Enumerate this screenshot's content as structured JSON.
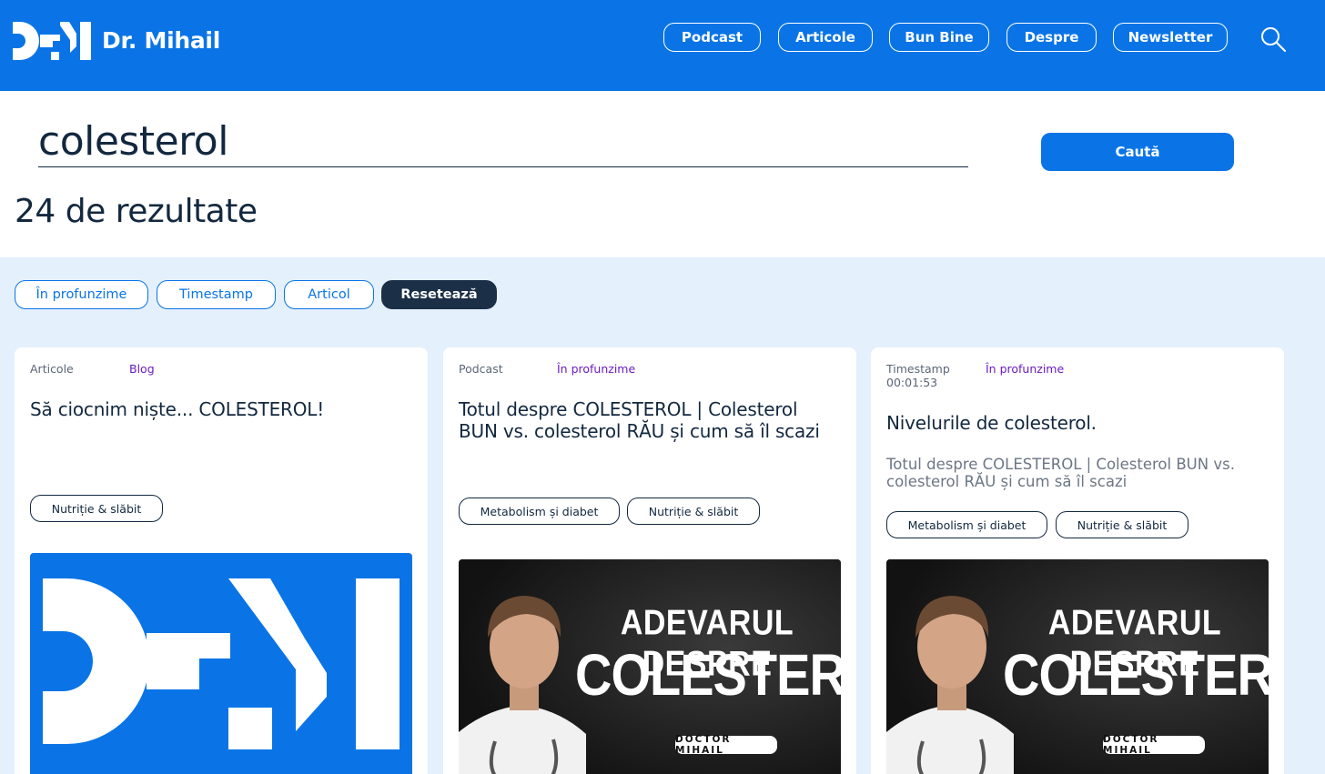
{
  "header": {
    "brand": "Dr. Mihail",
    "nav": [
      "Podcast",
      "Articole",
      "Bun Bine",
      "Despre",
      "Newsletter"
    ]
  },
  "search": {
    "query": "colesterol",
    "button_label": "Caută",
    "results_count": "24 de rezultate"
  },
  "filters": [
    "În profunzime",
    "Timestamp",
    "Articol",
    "Resetează"
  ],
  "cards": [
    {
      "type": "Articole",
      "tag": "Blog",
      "title": "Să ciocnim niște... COLESTEROL!",
      "chips": [
        "Nutriție & slăbit"
      ],
      "image": "logo-thumbnail"
    },
    {
      "type": "Podcast",
      "tag": "În profunzime",
      "title": "Totul despre COLESTEROL | Colesterol BUN vs. colesterol RĂU și cum să îl scazi",
      "chips": [
        "Metabolism și diabet",
        "Nutriție & slăbit"
      ],
      "image": "podcast-thumbnail",
      "thumb_line1": "ADEVARUL DESPRE",
      "thumb_line2": "COLESTEROL",
      "thumb_badge": "DOCTOR MIHAIL"
    },
    {
      "type": "Timestamp",
      "time": "00:01:53",
      "tag": "În profunzime",
      "title": "Nivelurile de colesterol.",
      "subtitle": "Totul despre COLESTEROL | Colesterol BUN vs. colesterol RĂU și cum să îl scazi",
      "chips": [
        "Metabolism și diabet",
        "Nutriție & slăbit"
      ],
      "image": "podcast-thumbnail",
      "thumb_line1": "ADEVARUL DESPRE",
      "thumb_line2": "COLESTEROL",
      "thumb_badge": "DOCTOR MIHAIL"
    }
  ],
  "colors": {
    "brand_blue": "#0a74e6",
    "navy": "#13283f",
    "results_bg": "#e4f0fb",
    "tag_purple": "#6a1cc0"
  }
}
